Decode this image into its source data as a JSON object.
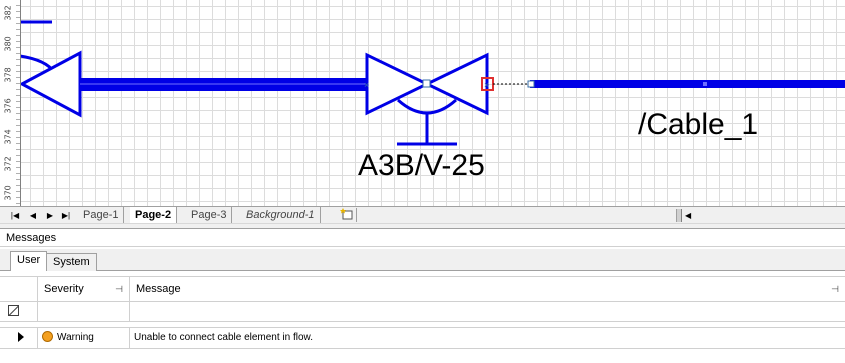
{
  "ruler": {
    "labels": [
      "382",
      "380",
      "378",
      "376",
      "374",
      "372",
      "370"
    ]
  },
  "diagram": {
    "valve_label": "A3B/V-25",
    "cable_label": "/Cable_1",
    "line_color": "#0000e6",
    "selection_color": "#e03030"
  },
  "page_tabs": {
    "tabs": [
      "Page-1",
      "Page-2",
      "Page-3",
      "Background-1"
    ],
    "active": "Page-2"
  },
  "messages": {
    "title": "Messages",
    "tabs": [
      "User",
      "System"
    ],
    "columns": {
      "severity": "Severity",
      "message": "Message"
    },
    "rows": [
      {
        "severity": "Warning",
        "message": "Unable to connect cable element in flow."
      }
    ],
    "warning_color": "#f4a020"
  }
}
